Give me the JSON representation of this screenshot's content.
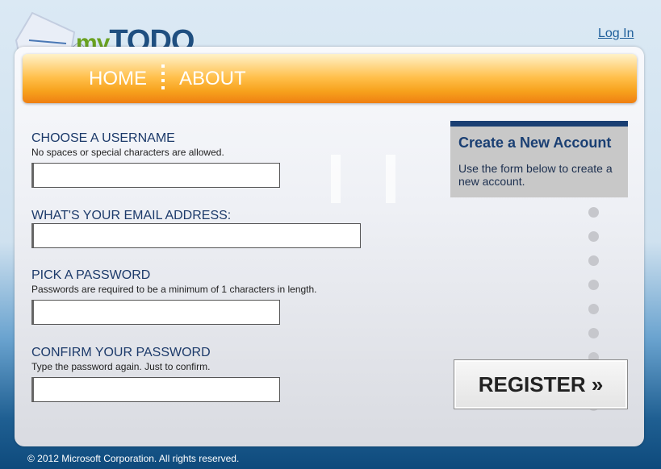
{
  "header": {
    "logo_my": "my",
    "logo_todo": "TODO",
    "login_link": "Log In"
  },
  "nav": {
    "items": [
      {
        "label": "HOME"
      },
      {
        "label": "ABOUT"
      }
    ]
  },
  "form": {
    "username": {
      "label": "CHOOSE A USERNAME",
      "hint": "No spaces or special characters are allowed.",
      "value": ""
    },
    "email": {
      "label": "WHAT'S YOUR EMAIL ADDRESS:",
      "value": ""
    },
    "password": {
      "label": "PICK A PASSWORD",
      "hint": "Passwords are required to be a minimum of 1 characters in length.",
      "value": ""
    },
    "confirm": {
      "label": "CONFIRM YOUR PASSWORD",
      "hint": "Type the password again. Just to confirm.",
      "value": ""
    }
  },
  "sidebar": {
    "title": "Create a New Account",
    "text": "Use the form below to create a new account."
  },
  "register_button": "REGISTER »",
  "footer": "© 2012 Microsoft Corporation. All rights reserved.",
  "colors": {
    "accent": "#f7a21d",
    "heading": "#1a3f73",
    "link": "#1f5f9b"
  }
}
